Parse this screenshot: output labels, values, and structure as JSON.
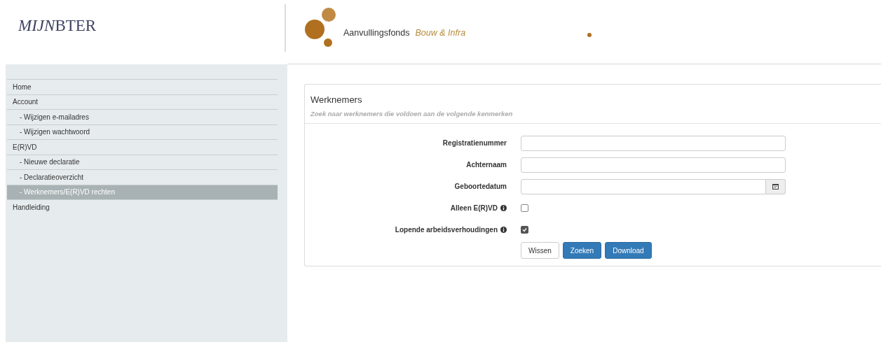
{
  "header": {
    "logo_italic": "MIJN",
    "logo_rest": "BTER",
    "brand_name": "Aanvullingsfonds",
    "brand_sub": "Bouw & Infra"
  },
  "sidebar": {
    "items": [
      {
        "label": "Home",
        "sub": false,
        "selected": false
      },
      {
        "label": "Account",
        "sub": false,
        "selected": false
      },
      {
        "label": "- Wijzigen e-mailadres",
        "sub": true,
        "selected": false
      },
      {
        "label": "- Wijzigen wachtwoord",
        "sub": true,
        "selected": false
      },
      {
        "label": "E(R)VD",
        "sub": false,
        "selected": false
      },
      {
        "label": "- Nieuwe declaratie",
        "sub": true,
        "selected": false
      },
      {
        "label": "- Declaratieoverzicht",
        "sub": true,
        "selected": false
      },
      {
        "label": "- Werknemers/E(R)VD rechten",
        "sub": true,
        "selected": true
      },
      {
        "label": "Handleiding",
        "sub": false,
        "selected": false
      }
    ]
  },
  "panel": {
    "title": "Werknemers",
    "subtitle": "Zoek naar werknemers die voldoen aan de volgende kenmerken",
    "fields": [
      {
        "kind": "text",
        "label": "Registratienummer"
      },
      {
        "kind": "text",
        "label": "Achternaam"
      },
      {
        "kind": "date",
        "label": "Geboortedatum"
      },
      {
        "kind": "checkbox",
        "label": "Alleen E(R)VD",
        "info": true,
        "checked": false
      },
      {
        "kind": "checkbox",
        "label": "Lopende arbeidsverhoudingen",
        "info": true,
        "checked": true
      }
    ],
    "buttons": [
      {
        "label": "Wissen",
        "kind": "default"
      },
      {
        "label": "Zoeken",
        "kind": "primary"
      },
      {
        "label": "Download",
        "kind": "primary"
      }
    ]
  }
}
